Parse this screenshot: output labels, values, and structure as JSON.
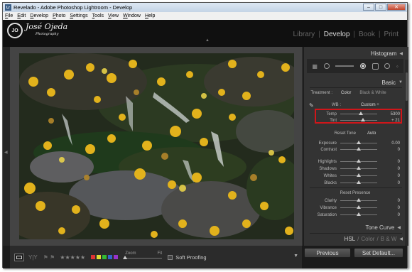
{
  "window": {
    "title": "Revelado - Adobe Photoshop Lightroom - Develop",
    "app_icon": "Lr",
    "buttons": {
      "minimize": "–",
      "maximize": "□",
      "close": "✕"
    }
  },
  "menu": [
    "File",
    "Edit",
    "Develop",
    "Photo",
    "Settings",
    "Tools",
    "View",
    "Window",
    "Help"
  ],
  "identity": {
    "initials": "JO",
    "name": "José Ojeda",
    "subtitle": "Photography"
  },
  "modules": {
    "items": [
      "Library",
      "Develop",
      "Book",
      "Print"
    ],
    "active": "Develop",
    "separator": "|"
  },
  "panels": {
    "histogram": {
      "title": "Histogram",
      "arrow": "◀"
    },
    "basic": {
      "title": "Basic",
      "arrow": "▼",
      "treatment_label": "Treatment :",
      "treatment_options": [
        "Color",
        "Black & White"
      ],
      "wb_label": "WB :",
      "wb_value": "Custom ÷",
      "temp": {
        "label": "Temp",
        "value": "5300",
        "level": 0.55
      },
      "tint": {
        "label": "Tint",
        "value": "+ 21",
        "level": 0.62
      },
      "tone_label": "Reset Tone",
      "auto_label": "Auto",
      "tone_sliders": [
        {
          "label": "Exposure",
          "value": "0.00",
          "level": 0.5
        },
        {
          "label": "Contrast",
          "value": "0",
          "level": 0.5
        },
        {
          "label": "Highlights",
          "value": "0",
          "level": 0.5
        },
        {
          "label": "Shadows",
          "value": "0",
          "level": 0.5
        },
        {
          "label": "Whites",
          "value": "0",
          "level": 0.5
        },
        {
          "label": "Blacks",
          "value": "0",
          "level": 0.5
        }
      ],
      "presence_label": "Reset Presence",
      "presence_sliders": [
        {
          "label": "Clarity",
          "value": "0",
          "level": 0.5
        },
        {
          "label": "Vibrance",
          "value": "0",
          "level": 0.5
        },
        {
          "label": "Saturation",
          "value": "0",
          "level": 0.5
        }
      ]
    },
    "tone_curve": {
      "title": "Tone Curve",
      "arrow": "◀"
    },
    "hsl": {
      "tabs": [
        "HSL",
        "Color",
        "B & W"
      ],
      "arrow": "◀"
    }
  },
  "toolbar": {
    "view_mode": "Loupe",
    "compare": "Y|Y",
    "flags": "⚑ ⚑",
    "stars": "★★★★★",
    "color_labels": [
      "#d33",
      "#dd3",
      "#3b3",
      "#36c",
      "#93c"
    ],
    "zoom_label": "Zoom",
    "zoom_fit": "Fit",
    "soft_proofing_label": "Soft Proofing",
    "arrow": "▼"
  },
  "buttons": {
    "previous": "Previous",
    "set_default": "Set Default..."
  },
  "side_arrows": {
    "left": "◀",
    "top": "▲"
  }
}
